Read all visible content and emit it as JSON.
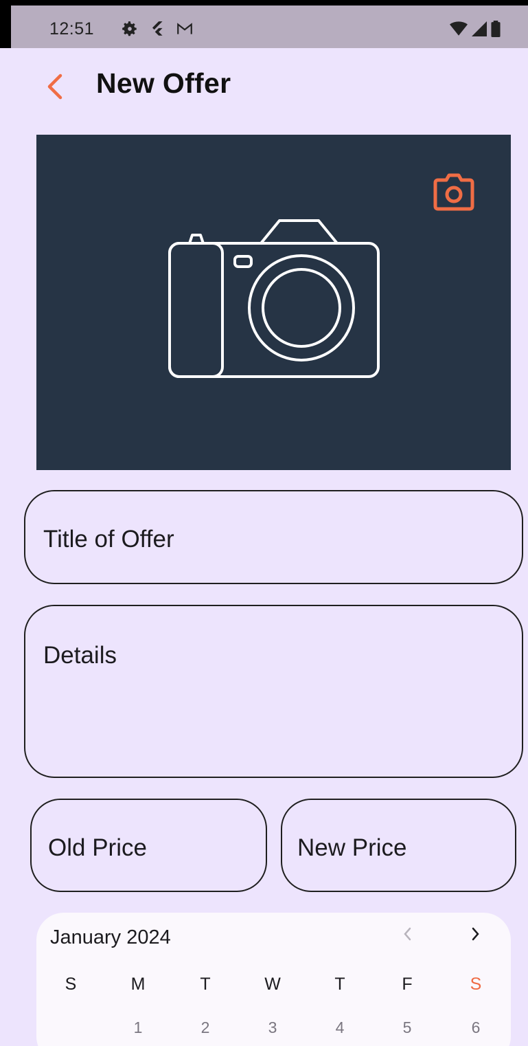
{
  "status_bar": {
    "time": "12:51",
    "icons": [
      "settings-icon",
      "flutter-icon",
      "gmail-icon"
    ],
    "right_icons": [
      "wifi-icon",
      "signal-icon",
      "battery-icon"
    ]
  },
  "app_bar": {
    "title": "New Offer",
    "back_icon": "chevron-left-icon"
  },
  "photo": {
    "placeholder_icon": "camera-outline-icon",
    "action_icon": "camera-icon"
  },
  "form": {
    "title_placeholder": "Title of Offer",
    "details_placeholder": "Details",
    "old_price_placeholder": "Old Price",
    "new_price_placeholder": "New Price"
  },
  "calendar": {
    "month_label": "January 2024",
    "weekdays": [
      "S",
      "M",
      "T",
      "W",
      "T",
      "F",
      "S"
    ],
    "first_row_days": [
      "",
      "1",
      "2",
      "3",
      "4",
      "5",
      "6"
    ]
  },
  "colors": {
    "accent": "#f06d45",
    "background": "#ede4fd",
    "photo_background": "#263445",
    "status_bar": "#b7adbf"
  }
}
